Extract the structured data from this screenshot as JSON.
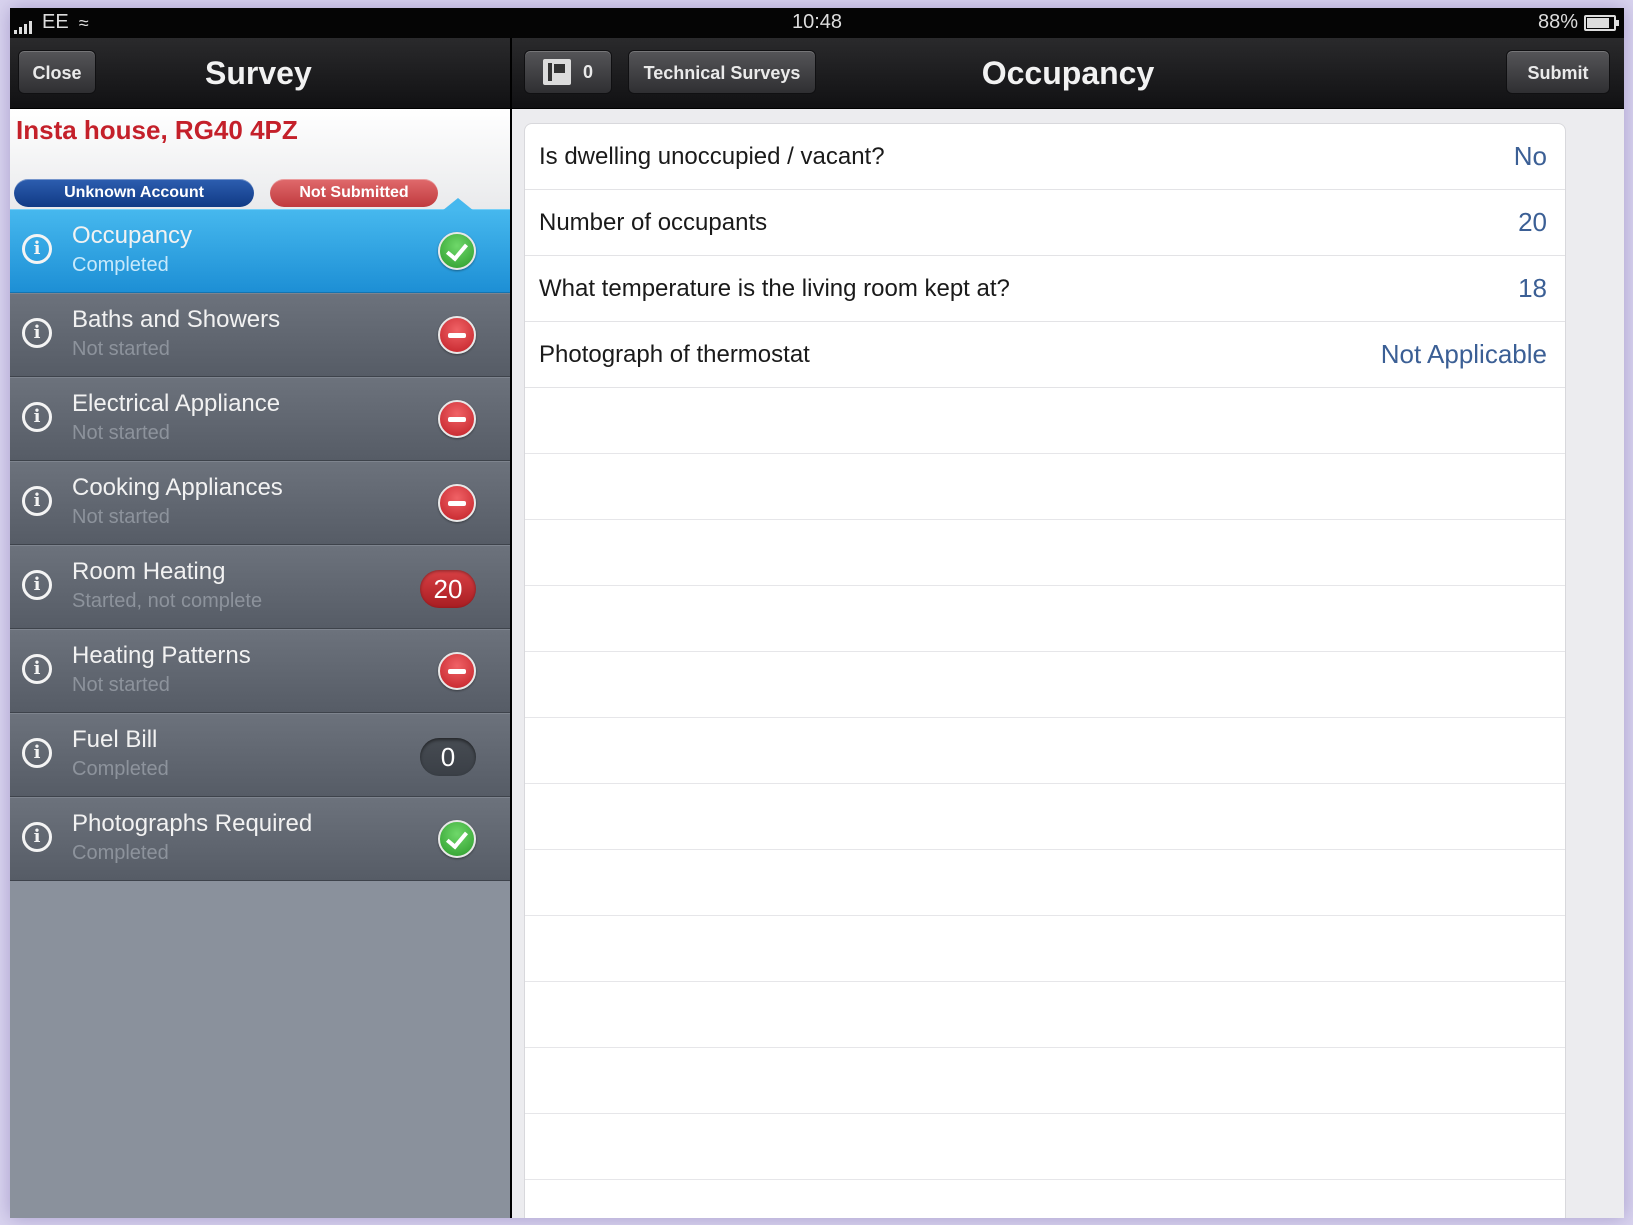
{
  "status_bar": {
    "carrier": "EE",
    "time": "10:48",
    "battery": "88%",
    "battery_level": 0.88
  },
  "left_nav": {
    "close_label": "Close",
    "title": "Survey"
  },
  "right_nav": {
    "count": "0",
    "technical_label": "Technical Surveys",
    "title": "Occupancy",
    "submit_label": "Submit"
  },
  "property": {
    "address": "Insta house, RG40 4PZ",
    "account_badge": "Unknown Account",
    "status_badge": "Not Submitted"
  },
  "sections": [
    {
      "name": "Occupancy",
      "status": "Completed",
      "indicator": "check"
    },
    {
      "name": "Baths and Showers",
      "status": "Not started",
      "indicator": "minus"
    },
    {
      "name": "Electrical Appliance",
      "status": "Not started",
      "indicator": "minus"
    },
    {
      "name": "Cooking Appliances",
      "status": "Not started",
      "indicator": "minus"
    },
    {
      "name": "Room Heating",
      "status": "Started, not complete",
      "indicator": "count-red",
      "count": "20"
    },
    {
      "name": "Heating Patterns",
      "status": "Not started",
      "indicator": "minus"
    },
    {
      "name": "Fuel Bill",
      "status": "Completed",
      "indicator": "count-dark",
      "count": "0"
    },
    {
      "name": "Photographs Required",
      "status": "Completed",
      "indicator": "check"
    }
  ],
  "questions": [
    {
      "question": "Is dwelling unoccupied / vacant?",
      "answer": "No"
    },
    {
      "question": "Number of occupants",
      "answer": "20"
    },
    {
      "question": "What temperature is the living room kept at?",
      "answer": "18"
    },
    {
      "question": "Photograph of thermostat",
      "answer": "Not Applicable"
    }
  ],
  "colors": {
    "accent_blue": "#1d8fd5",
    "address_red": "#c4202a",
    "answer_blue": "#3b5f95"
  }
}
